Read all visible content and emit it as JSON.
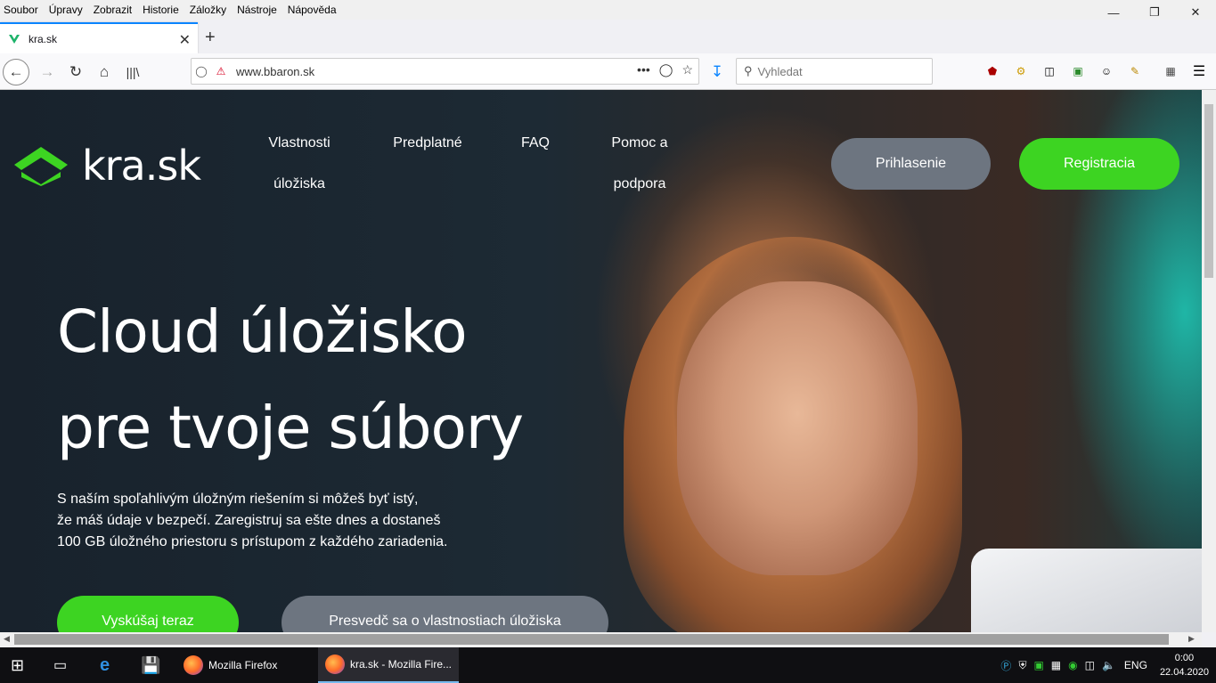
{
  "menu": [
    "Soubor",
    "Úpravy",
    "Zobrazit",
    "Historie",
    "Záložky",
    "Nástroje",
    "Nápověda"
  ],
  "tab": {
    "title": "kra.sk"
  },
  "navbar": {
    "url": "www.bbaron.sk",
    "search_placeholder": "Vyhledat"
  },
  "site": {
    "logo_text": "kra.sk",
    "nav": [
      {
        "line1": "Vlastnosti",
        "line2": "úložiska"
      },
      {
        "line1": "Predplatné",
        "line2": ""
      },
      {
        "line1": "FAQ",
        "line2": ""
      },
      {
        "line1": "Pomoc a",
        "line2": "podpora"
      }
    ],
    "login_label": "Prihlasenie",
    "register_label": "Registracia",
    "hero_line1": "Cloud úložisko",
    "hero_line2": "pre tvoje súbory",
    "hero_sub_line1": "S naším spoľahlivým úložným riešením si môžeš byť istý,",
    "hero_sub_line2": "že máš údaje v bezpečí. Zaregistruj sa ešte dnes a dostaneš",
    "hero_sub_line3": "100 GB úložného priestoru s prístupom z každého zariadenia.",
    "cta_try": "Vyskúšaj teraz",
    "cta_features": "Presvedč sa o vlastnostiach úložiska",
    "accent_green": "#3dd422",
    "button_gray": "#6d7580"
  },
  "taskbar": {
    "apps": [
      {
        "label": "Mozilla Firefox"
      },
      {
        "label": "kra.sk - Mozilla Fire..."
      }
    ],
    "lang": "ENG",
    "time": "0:00",
    "date": "22.04.2020"
  }
}
